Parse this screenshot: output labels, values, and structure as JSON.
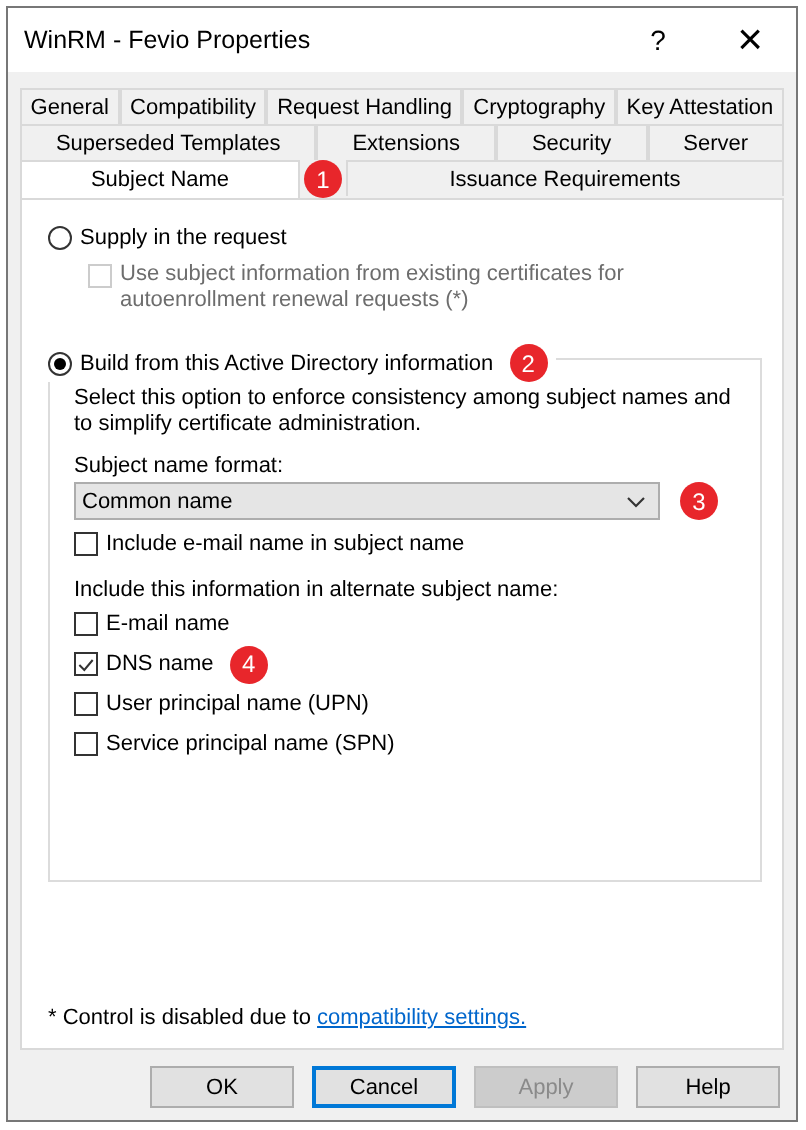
{
  "window": {
    "title": "WinRM - Fevio Properties",
    "help_button": "?",
    "close_button": "×"
  },
  "tab_rows": [
    [
      {
        "label": "General",
        "selected": false
      },
      {
        "label": "Compatibility",
        "selected": false
      },
      {
        "label": "Request Handling",
        "selected": false
      },
      {
        "label": "Cryptography",
        "selected": false
      },
      {
        "label": "Key Attestation",
        "selected": false
      }
    ],
    [
      {
        "label": "Superseded Templates",
        "selected": false
      },
      {
        "label": "Extensions",
        "selected": false
      },
      {
        "label": "Security",
        "selected": false
      },
      {
        "label": "Server",
        "selected": false
      }
    ],
    [
      {
        "label": "Subject Name",
        "selected": true
      },
      {
        "label": "Issuance Requirements",
        "selected": false
      }
    ]
  ],
  "supply_option": {
    "label": "Supply in the request",
    "selected": false,
    "sub_checkbox": {
      "label": "Use subject information from existing certificates for autoenrollment renewal requests (*)",
      "checked": false,
      "disabled": true
    }
  },
  "build_option": {
    "label": "Build from this Active Directory information",
    "selected": true,
    "description": "Select this option to enforce consistency among subject names and to simplify certificate administration.",
    "format_label": "Subject name format:",
    "format_value": "Common name",
    "include_email": {
      "label": "Include e-mail name in subject name",
      "checked": false
    },
    "alternate_label": "Include this information in alternate subject name:",
    "alternate": [
      {
        "label": "E-mail name",
        "checked": false
      },
      {
        "label": "DNS name",
        "checked": true
      },
      {
        "label": "User principal name (UPN)",
        "checked": false
      },
      {
        "label": "Service principal name (SPN)",
        "checked": false
      }
    ]
  },
  "footnote": {
    "text": "* Control is disabled due to",
    "link": "compatibility settings."
  },
  "buttons": [
    {
      "label": "OK",
      "kind": "normal"
    },
    {
      "label": "Cancel",
      "kind": "default"
    },
    {
      "label": "Apply",
      "kind": "disabled"
    },
    {
      "label": "Help",
      "kind": "normal"
    }
  ],
  "callouts": [
    {
      "label": "1"
    },
    {
      "label": "2"
    },
    {
      "label": "3"
    },
    {
      "label": "4"
    }
  ]
}
